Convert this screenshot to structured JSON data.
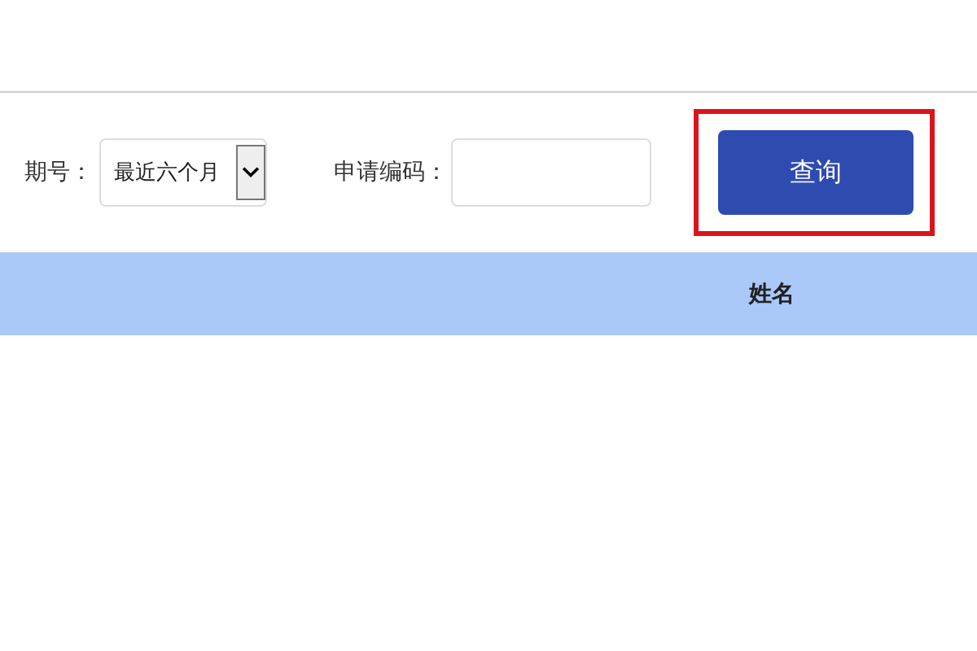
{
  "filter": {
    "period_label": "期号：",
    "period_value": "最近六个月",
    "code_label": "申请编码："
  },
  "search_button": {
    "label": "查询",
    "highlighted": true
  },
  "table": {
    "columns": [
      "姓名"
    ]
  }
}
